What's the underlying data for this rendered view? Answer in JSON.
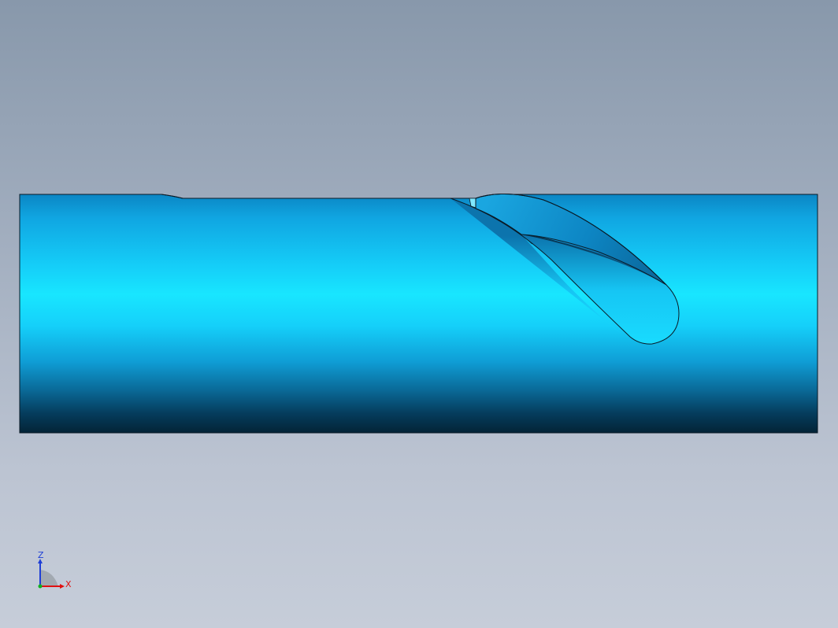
{
  "viewport": {
    "model": "cylindrical-shaft-with-helical-groove",
    "colors": {
      "background_top": "#8898ab",
      "background_bottom": "#c6cdd9",
      "part_highlight": "#18e6ff",
      "part_mid": "#11a9e0",
      "part_shadow": "#062a40",
      "edge": "#0a1a26"
    }
  },
  "triad": {
    "z_label": "Z",
    "x_label": "X",
    "colors": {
      "z": "#1f3fd6",
      "x": "#e01010",
      "y": "#10b020"
    }
  }
}
